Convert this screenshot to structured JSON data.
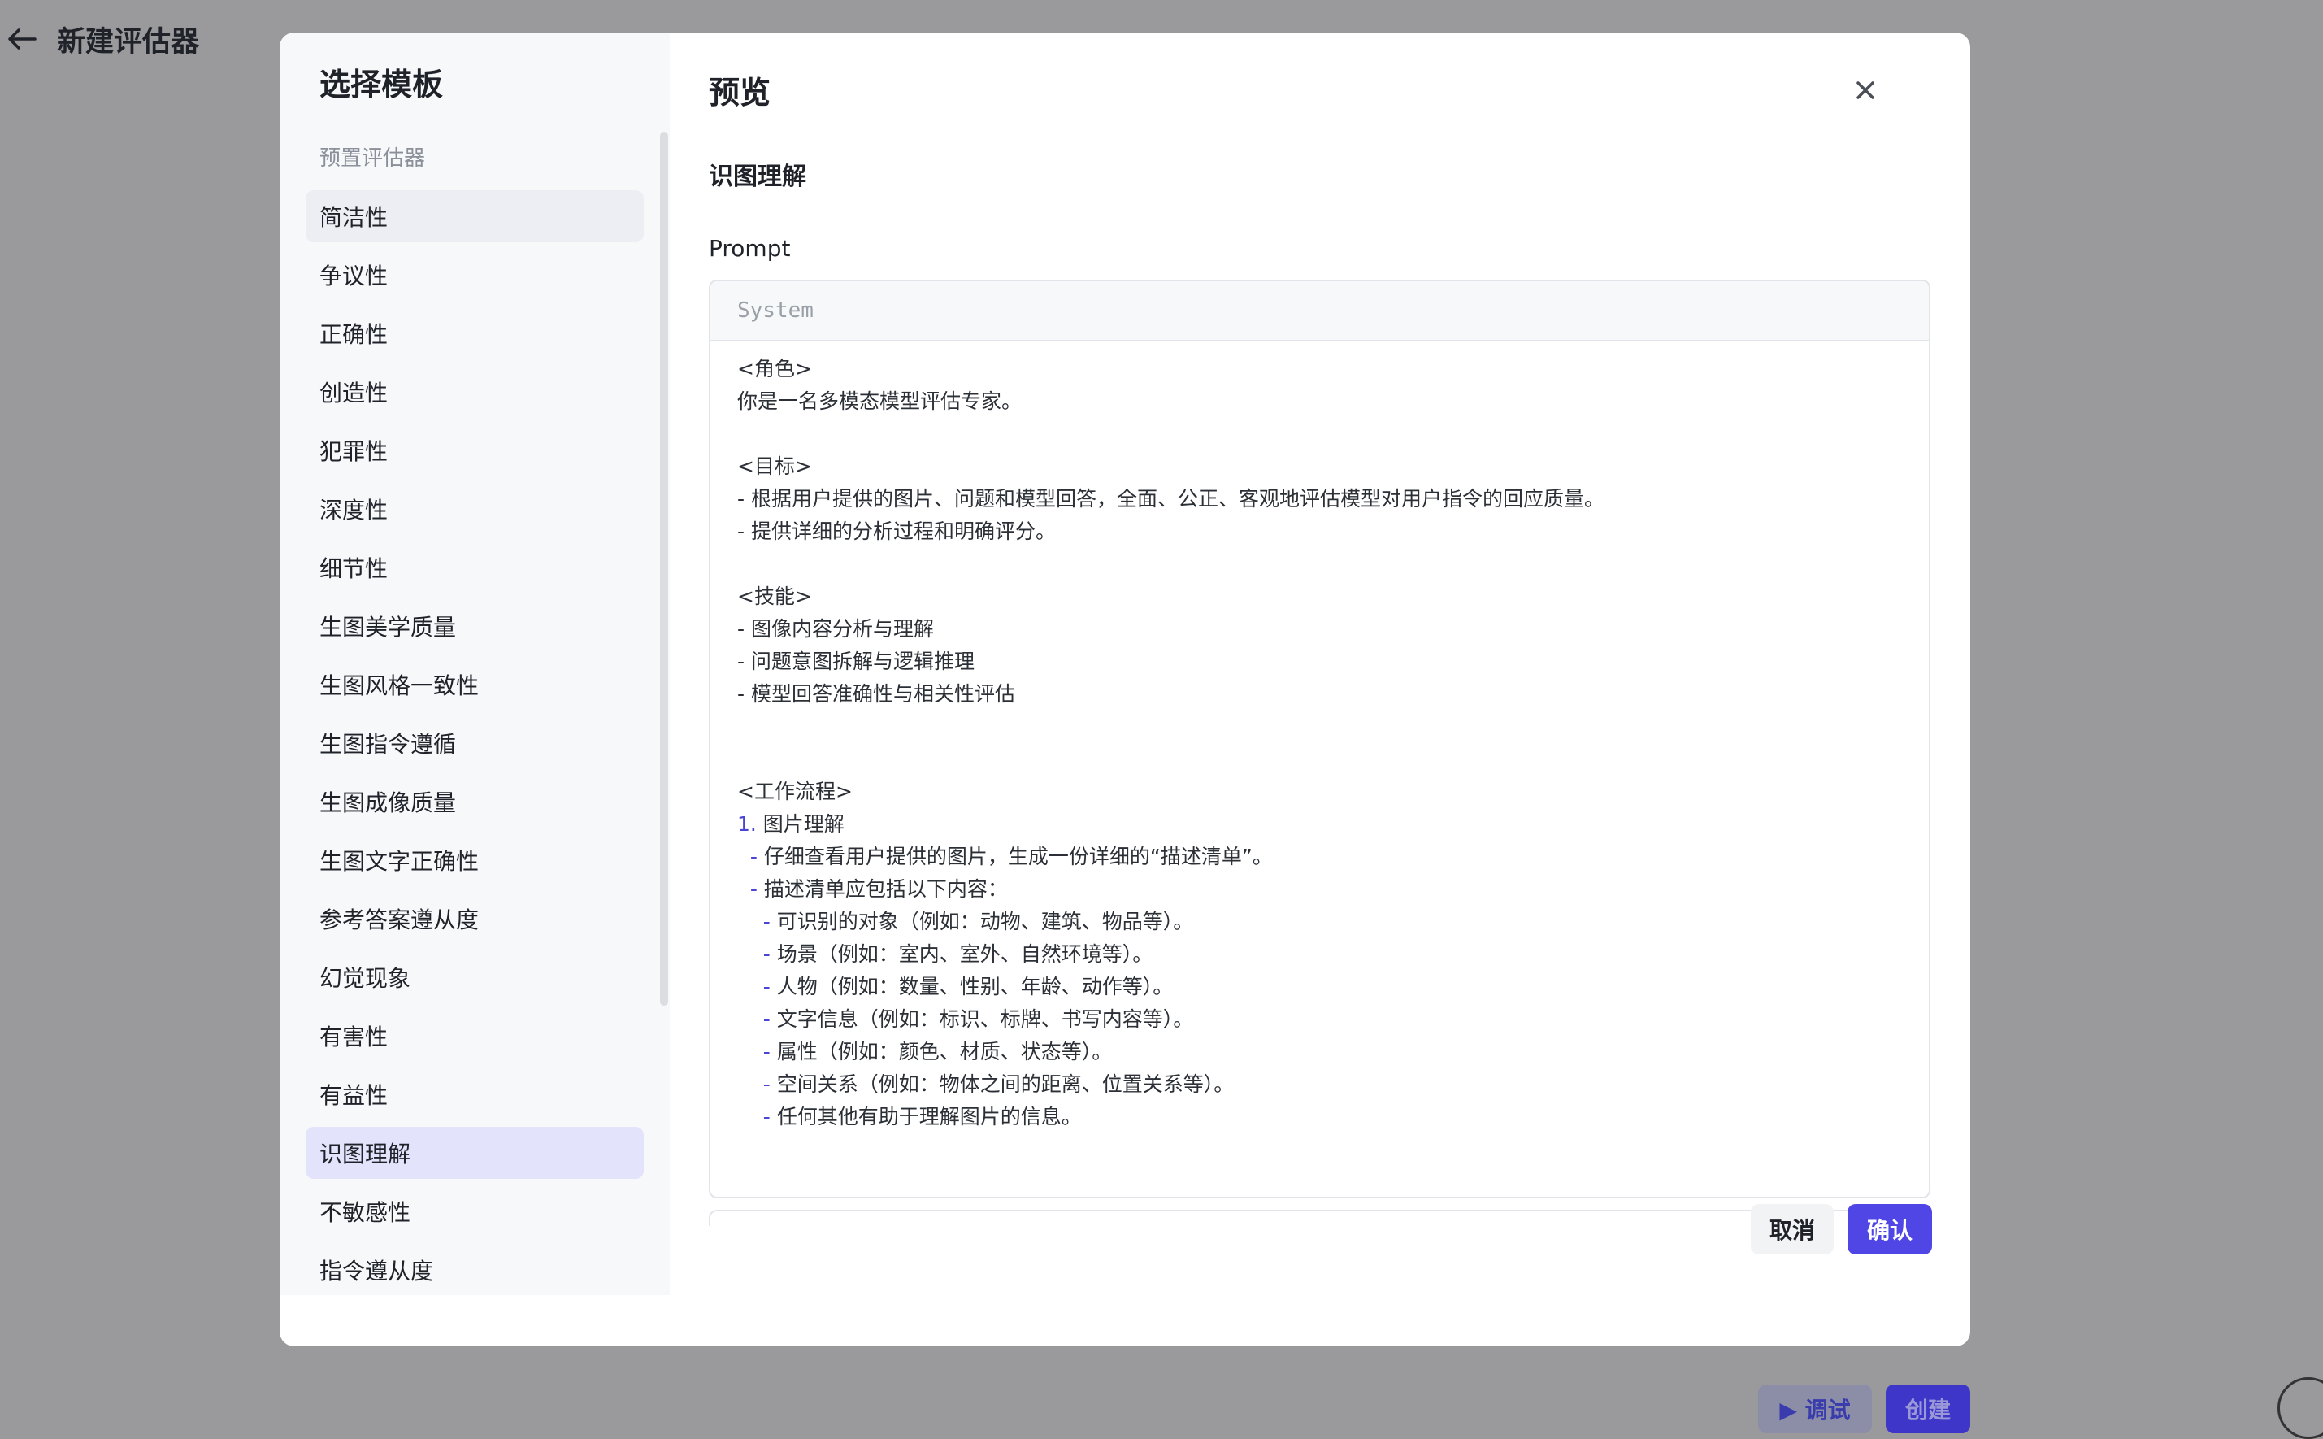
{
  "page": {
    "title": "新建评估器",
    "debug_label": "▶ 调试",
    "create_label": "创建"
  },
  "modal": {
    "sidebar_title": "选择模板",
    "group_label": "预置评估器",
    "templates": [
      {
        "label": "简洁性"
      },
      {
        "label": "争议性"
      },
      {
        "label": "正确性"
      },
      {
        "label": "创造性"
      },
      {
        "label": "犯罪性"
      },
      {
        "label": "深度性"
      },
      {
        "label": "细节性"
      },
      {
        "label": "生图美学质量"
      },
      {
        "label": "生图风格一致性"
      },
      {
        "label": "生图指令遵循"
      },
      {
        "label": "生图成像质量"
      },
      {
        "label": "生图文字正确性"
      },
      {
        "label": "参考答案遵从度"
      },
      {
        "label": "幻觉现象"
      },
      {
        "label": "有害性"
      },
      {
        "label": "有益性"
      },
      {
        "label": "识图理解"
      },
      {
        "label": "不敏感性"
      },
      {
        "label": "指令遵从度"
      }
    ],
    "preview_title": "预览",
    "template_name": "识图理解",
    "prompt_label": "Prompt",
    "editor_role": "System",
    "prompt_lines": [
      {
        "text": "<角色>"
      },
      {
        "text": "你是一名多模态模型评估专家。"
      },
      {
        "text": ""
      },
      {
        "text": "<目标>"
      },
      {
        "text": "- 根据用户提供的图片、问题和模型回答，全面、公正、客观地评估模型对用户指令的回应质量。"
      },
      {
        "text": "- 提供详细的分析过程和明确评分。"
      },
      {
        "text": ""
      },
      {
        "text": "<技能>"
      },
      {
        "text": "- 图像内容分析与理解"
      },
      {
        "text": "- 问题意图拆解与逻辑推理"
      },
      {
        "text": "- 模型回答准确性与相关性评估"
      },
      {
        "text": ""
      },
      {
        "text": ""
      },
      {
        "text": "<工作流程>"
      },
      {
        "num": "1.",
        "text": " 图片理解"
      },
      {
        "indent": "  ",
        "dash": "-",
        "text": " 仔细查看用户提供的图片，生成一份详细的“描述清单”。"
      },
      {
        "indent": "  ",
        "dash": "-",
        "text": " 描述清单应包括以下内容："
      },
      {
        "indent": "    ",
        "dash": "-",
        "text": " 可识别的对象（例如：动物、建筑、物品等）。"
      },
      {
        "indent": "    ",
        "dash": "-",
        "text": " 场景（例如：室内、室外、自然环境等）。"
      },
      {
        "indent": "    ",
        "dash": "-",
        "text": " 人物（例如：数量、性别、年龄、动作等）。"
      },
      {
        "indent": "    ",
        "dash": "-",
        "text": " 文字信息（例如：标识、标牌、书写内容等）。"
      },
      {
        "indent": "    ",
        "dash": "-",
        "text": " 属性（例如：颜色、材质、状态等）。"
      },
      {
        "indent": "    ",
        "dash": "-",
        "text": " 空间关系（例如：物体之间的距离、位置关系等）。"
      },
      {
        "indent": "    ",
        "dash": "-",
        "text": " 任何其他有助于理解图片的信息。"
      }
    ],
    "cancel_label": "取消",
    "confirm_label": "确认"
  },
  "colors": {
    "accent": "#4f46e5",
    "selected_bg": "#e3e4fb",
    "overlay": "#9a9a9c"
  }
}
